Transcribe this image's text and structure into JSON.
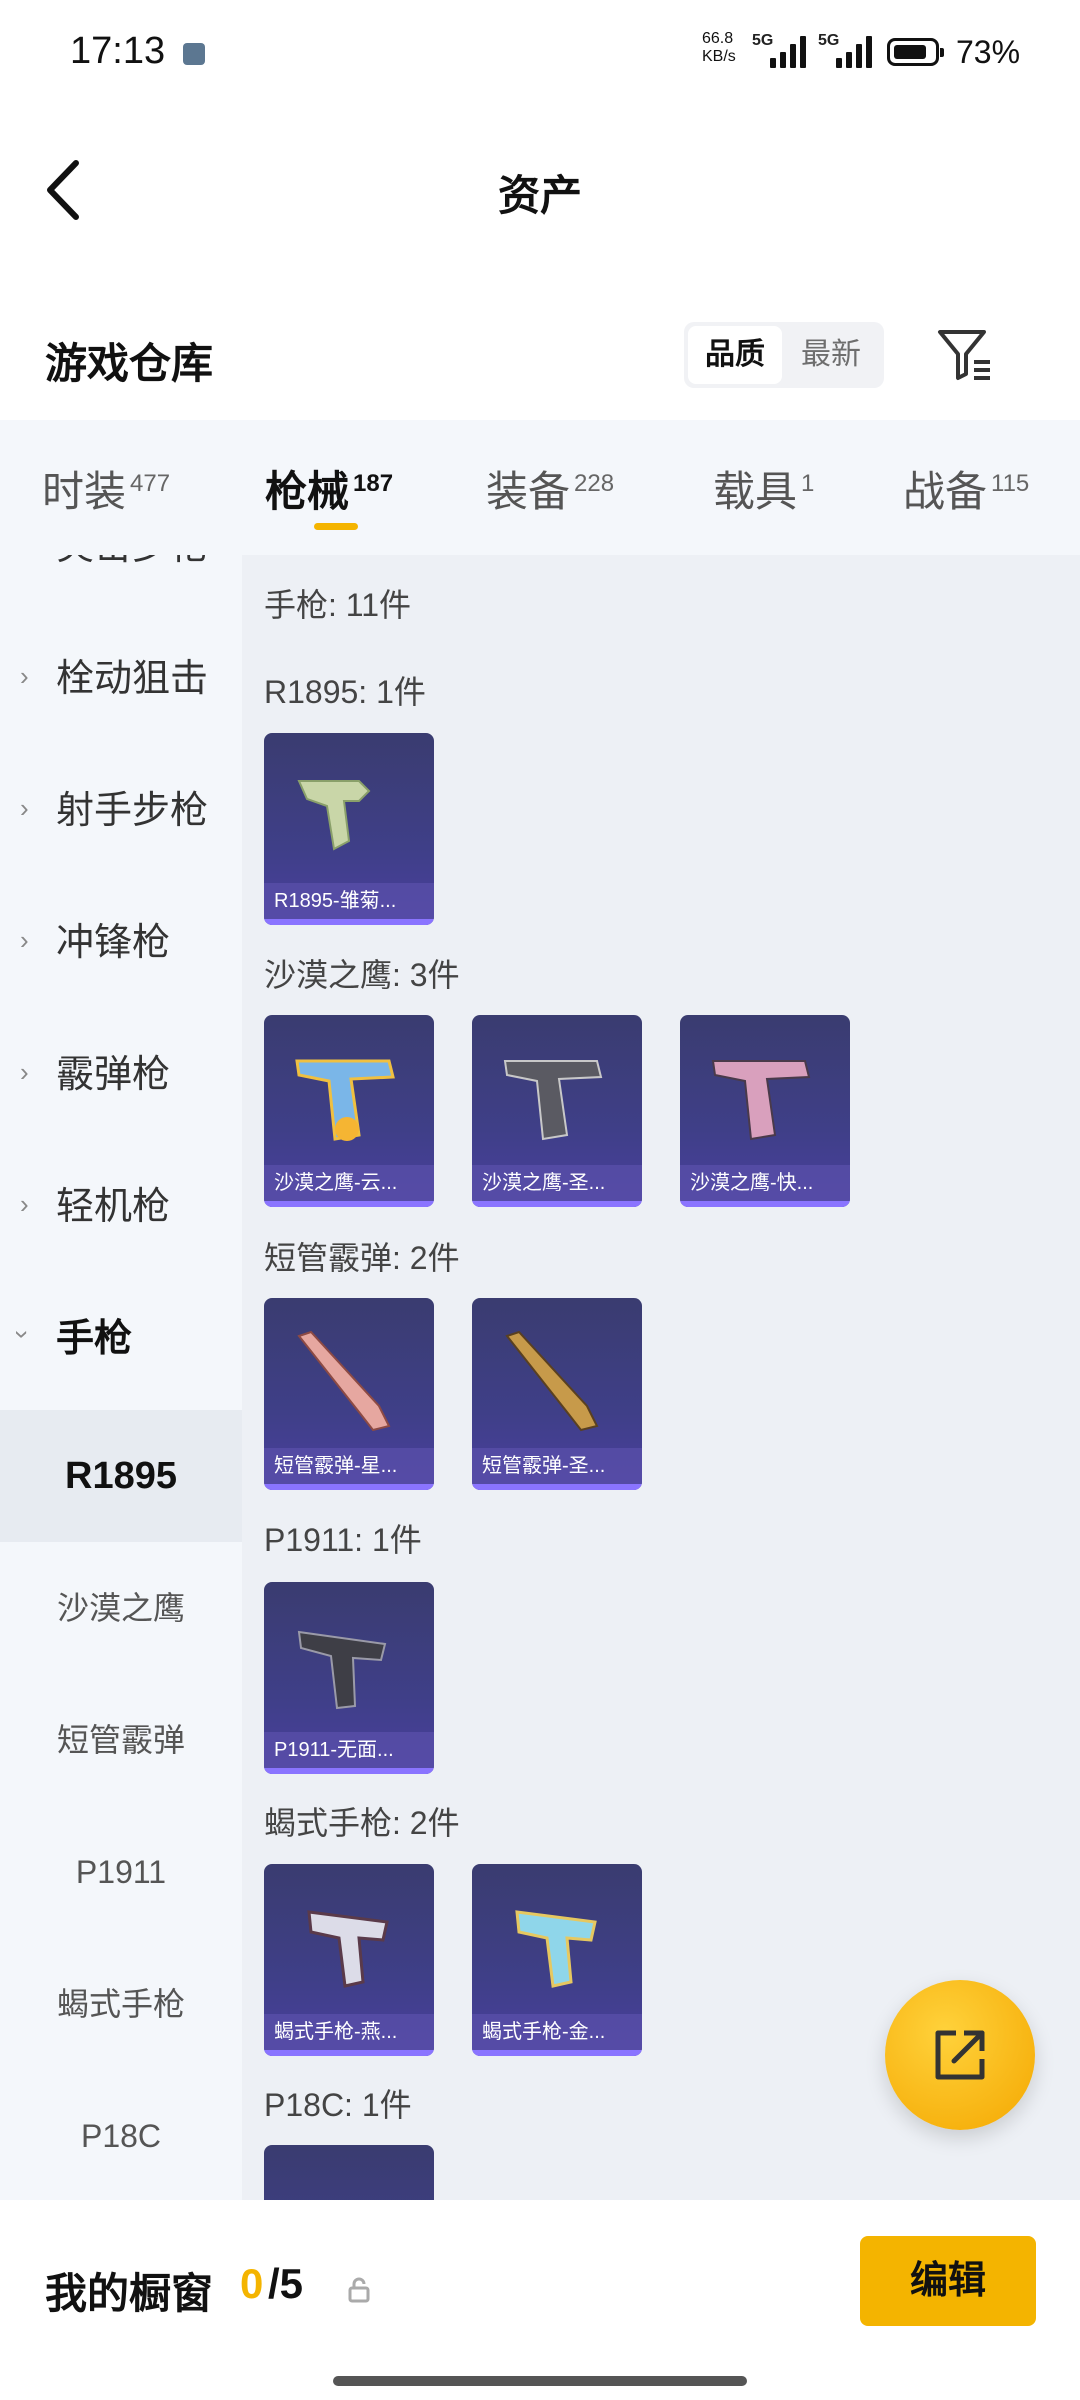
{
  "status": {
    "time": "17:13",
    "net_speed": "66.8",
    "net_unit": "KB/s",
    "sig1": "5G",
    "sig2": "5G",
    "battery": "73%"
  },
  "header": {
    "title": "资产"
  },
  "warehouse": {
    "title": "游戏仓库",
    "sort_quality": "品质",
    "sort_latest": "最新"
  },
  "tabs": [
    {
      "label": "时装",
      "count": "477"
    },
    {
      "label": "枪械",
      "count": "187"
    },
    {
      "label": "装备",
      "count": "228"
    },
    {
      "label": "载具",
      "count": "1"
    },
    {
      "label": "战备",
      "count": "115"
    }
  ],
  "sidebar": {
    "categories": [
      "突击步枪",
      "栓动狙击",
      "射手步枪",
      "冲锋枪",
      "霰弹枪",
      "轻机枪",
      "手枪"
    ],
    "subitems": [
      "R1895",
      "沙漠之鹰",
      "短管霰弹",
      "P1911",
      "蝎式手枪",
      "P18C"
    ]
  },
  "content": {
    "total": "手枪: 11件",
    "groups": [
      {
        "title": "R1895: 1件",
        "items": [
          "R1895-雏菊..."
        ]
      },
      {
        "title": "沙漠之鹰: 3件",
        "items": [
          "沙漠之鹰-云...",
          "沙漠之鹰-圣...",
          "沙漠之鹰-快..."
        ]
      },
      {
        "title": "短管霰弹: 2件",
        "items": [
          "短管霰弹-星...",
          "短管霰弹-圣..."
        ]
      },
      {
        "title": "P1911: 1件",
        "items": [
          "P1911-无面..."
        ]
      },
      {
        "title": "蝎式手枪: 2件",
        "items": [
          "蝎式手枪-燕...",
          "蝎式手枪-金..."
        ]
      },
      {
        "title": "P18C: 1件",
        "items": []
      }
    ]
  },
  "bottom": {
    "label": "我的橱窗",
    "current": "0",
    "total": "/5",
    "edit": "编辑"
  },
  "icons": {
    "back": "back-arrow-icon",
    "filter": "filter-icon",
    "fab": "share-icon",
    "lock": "lock-icon"
  },
  "colors": {
    "accent": "#f4b400",
    "card": "#3f3f88"
  }
}
